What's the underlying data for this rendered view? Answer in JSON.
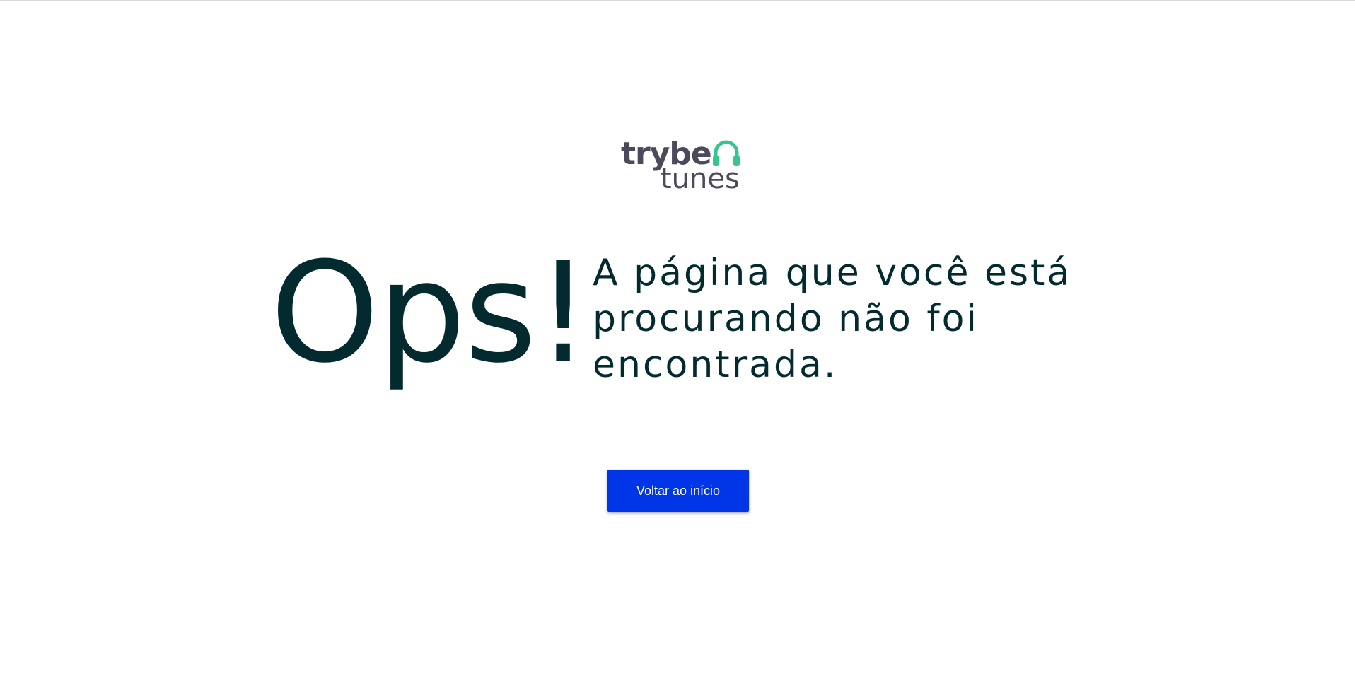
{
  "logo": {
    "line1": "trybe",
    "line2": "tunes",
    "icon": "headphones-icon",
    "text_color": "#4c4a5a",
    "icon_color": "#36c58f"
  },
  "error": {
    "heading": "Ops!",
    "message": "A página que você está procurando não foi encontrada."
  },
  "actions": {
    "back_label": "Voltar ao início"
  },
  "colors": {
    "text": "#032a2f",
    "button": "#0036e8",
    "button_text": "#ffffff",
    "background": "#ffffff"
  }
}
